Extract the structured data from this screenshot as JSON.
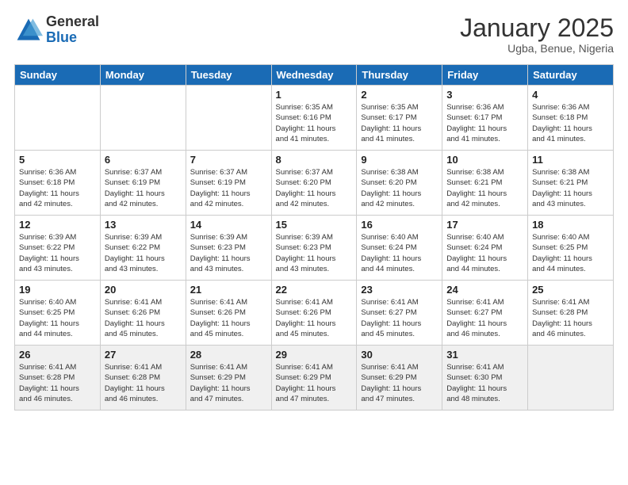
{
  "header": {
    "logo_general": "General",
    "logo_blue": "Blue",
    "month_title": "January 2025",
    "location": "Ugba, Benue, Nigeria"
  },
  "weekdays": [
    "Sunday",
    "Monday",
    "Tuesday",
    "Wednesday",
    "Thursday",
    "Friday",
    "Saturday"
  ],
  "weeks": [
    [
      {
        "day": "",
        "info": ""
      },
      {
        "day": "",
        "info": ""
      },
      {
        "day": "",
        "info": ""
      },
      {
        "day": "1",
        "info": "Sunrise: 6:35 AM\nSunset: 6:16 PM\nDaylight: 11 hours\nand 41 minutes."
      },
      {
        "day": "2",
        "info": "Sunrise: 6:35 AM\nSunset: 6:17 PM\nDaylight: 11 hours\nand 41 minutes."
      },
      {
        "day": "3",
        "info": "Sunrise: 6:36 AM\nSunset: 6:17 PM\nDaylight: 11 hours\nand 41 minutes."
      },
      {
        "day": "4",
        "info": "Sunrise: 6:36 AM\nSunset: 6:18 PM\nDaylight: 11 hours\nand 41 minutes."
      }
    ],
    [
      {
        "day": "5",
        "info": "Sunrise: 6:36 AM\nSunset: 6:18 PM\nDaylight: 11 hours\nand 42 minutes."
      },
      {
        "day": "6",
        "info": "Sunrise: 6:37 AM\nSunset: 6:19 PM\nDaylight: 11 hours\nand 42 minutes."
      },
      {
        "day": "7",
        "info": "Sunrise: 6:37 AM\nSunset: 6:19 PM\nDaylight: 11 hours\nand 42 minutes."
      },
      {
        "day": "8",
        "info": "Sunrise: 6:37 AM\nSunset: 6:20 PM\nDaylight: 11 hours\nand 42 minutes."
      },
      {
        "day": "9",
        "info": "Sunrise: 6:38 AM\nSunset: 6:20 PM\nDaylight: 11 hours\nand 42 minutes."
      },
      {
        "day": "10",
        "info": "Sunrise: 6:38 AM\nSunset: 6:21 PM\nDaylight: 11 hours\nand 42 minutes."
      },
      {
        "day": "11",
        "info": "Sunrise: 6:38 AM\nSunset: 6:21 PM\nDaylight: 11 hours\nand 43 minutes."
      }
    ],
    [
      {
        "day": "12",
        "info": "Sunrise: 6:39 AM\nSunset: 6:22 PM\nDaylight: 11 hours\nand 43 minutes."
      },
      {
        "day": "13",
        "info": "Sunrise: 6:39 AM\nSunset: 6:22 PM\nDaylight: 11 hours\nand 43 minutes."
      },
      {
        "day": "14",
        "info": "Sunrise: 6:39 AM\nSunset: 6:23 PM\nDaylight: 11 hours\nand 43 minutes."
      },
      {
        "day": "15",
        "info": "Sunrise: 6:39 AM\nSunset: 6:23 PM\nDaylight: 11 hours\nand 43 minutes."
      },
      {
        "day": "16",
        "info": "Sunrise: 6:40 AM\nSunset: 6:24 PM\nDaylight: 11 hours\nand 44 minutes."
      },
      {
        "day": "17",
        "info": "Sunrise: 6:40 AM\nSunset: 6:24 PM\nDaylight: 11 hours\nand 44 minutes."
      },
      {
        "day": "18",
        "info": "Sunrise: 6:40 AM\nSunset: 6:25 PM\nDaylight: 11 hours\nand 44 minutes."
      }
    ],
    [
      {
        "day": "19",
        "info": "Sunrise: 6:40 AM\nSunset: 6:25 PM\nDaylight: 11 hours\nand 44 minutes."
      },
      {
        "day": "20",
        "info": "Sunrise: 6:41 AM\nSunset: 6:26 PM\nDaylight: 11 hours\nand 45 minutes."
      },
      {
        "day": "21",
        "info": "Sunrise: 6:41 AM\nSunset: 6:26 PM\nDaylight: 11 hours\nand 45 minutes."
      },
      {
        "day": "22",
        "info": "Sunrise: 6:41 AM\nSunset: 6:26 PM\nDaylight: 11 hours\nand 45 minutes."
      },
      {
        "day": "23",
        "info": "Sunrise: 6:41 AM\nSunset: 6:27 PM\nDaylight: 11 hours\nand 45 minutes."
      },
      {
        "day": "24",
        "info": "Sunrise: 6:41 AM\nSunset: 6:27 PM\nDaylight: 11 hours\nand 46 minutes."
      },
      {
        "day": "25",
        "info": "Sunrise: 6:41 AM\nSunset: 6:28 PM\nDaylight: 11 hours\nand 46 minutes."
      }
    ],
    [
      {
        "day": "26",
        "info": "Sunrise: 6:41 AM\nSunset: 6:28 PM\nDaylight: 11 hours\nand 46 minutes."
      },
      {
        "day": "27",
        "info": "Sunrise: 6:41 AM\nSunset: 6:28 PM\nDaylight: 11 hours\nand 46 minutes."
      },
      {
        "day": "28",
        "info": "Sunrise: 6:41 AM\nSunset: 6:29 PM\nDaylight: 11 hours\nand 47 minutes."
      },
      {
        "day": "29",
        "info": "Sunrise: 6:41 AM\nSunset: 6:29 PM\nDaylight: 11 hours\nand 47 minutes."
      },
      {
        "day": "30",
        "info": "Sunrise: 6:41 AM\nSunset: 6:29 PM\nDaylight: 11 hours\nand 47 minutes."
      },
      {
        "day": "31",
        "info": "Sunrise: 6:41 AM\nSunset: 6:30 PM\nDaylight: 11 hours\nand 48 minutes."
      },
      {
        "day": "",
        "info": ""
      }
    ]
  ]
}
